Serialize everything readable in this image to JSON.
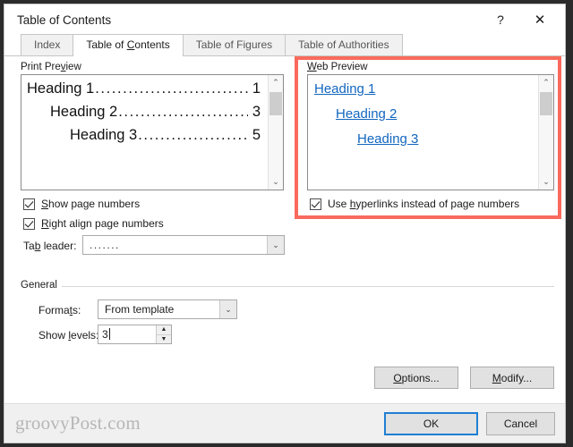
{
  "window": {
    "title": "Table of Contents",
    "help_icon": "?",
    "close_icon": "✕"
  },
  "tabs": [
    {
      "label": "Index",
      "active": false
    },
    {
      "label": "Table of Contents",
      "active": true
    },
    {
      "label": "Table of Figures",
      "active": false
    },
    {
      "label": "Table of Authorities",
      "active": false
    }
  ],
  "print_preview": {
    "group_label": "Print Preview",
    "lines": [
      {
        "text": "Heading 1",
        "leader": "...............................",
        "page": "1",
        "indent": 0
      },
      {
        "text": "Heading 2",
        "leader": ".............................",
        "page": "3",
        "indent": 1
      },
      {
        "text": "Heading 3",
        "leader": "........................",
        "page": "5",
        "indent": 2
      }
    ],
    "scroll_up_icon": "⌃",
    "scroll_down_icon": "⌄"
  },
  "web_preview": {
    "group_label": "Web Preview",
    "group_label_accel": "W",
    "links": [
      {
        "text": "Heading 1",
        "indent": 0
      },
      {
        "text": "Heading 2",
        "indent": 1
      },
      {
        "text": "Heading 3",
        "indent": 2
      }
    ],
    "scroll_up_icon": "⌃",
    "scroll_down_icon": "⌄",
    "link_color": "#1266bf"
  },
  "options": {
    "show_page_numbers": {
      "label_pre": "",
      "accel": "S",
      "label_post": "how page numbers",
      "checked": true
    },
    "right_align_page_numbers": {
      "label_pre": "",
      "accel": "R",
      "label_post": "ight align page numbers",
      "checked": true
    },
    "use_hyperlinks": {
      "label_pre": "Use ",
      "accel": "h",
      "label_post": "yperlinks instead of page numbers",
      "checked": true
    },
    "tab_leader": {
      "label_pre": "Ta",
      "accel": "b",
      "label_post": " leader:",
      "value": ".......",
      "arrow_icon": "⌄"
    }
  },
  "general": {
    "group_label": "General",
    "formats": {
      "label_pre": "Forma",
      "accel": "t",
      "label_post": "s:",
      "value": "From template",
      "arrow_icon": "⌄"
    },
    "show_levels": {
      "label_pre": "Show ",
      "accel": "l",
      "label_post": "evels:",
      "value": "3",
      "up_icon": "▲",
      "down_icon": "▼"
    }
  },
  "buttons": {
    "options": {
      "pre": "",
      "accel": "O",
      "post": "ptions..."
    },
    "modify": {
      "pre": "",
      "accel": "M",
      "post": "odify..."
    },
    "ok": {
      "label": "OK",
      "focused": true
    },
    "cancel": {
      "label": "Cancel",
      "focused": false
    }
  },
  "footer": {
    "watermark": "groovyPost.com"
  },
  "highlight": {
    "color": "#f96a5d"
  }
}
